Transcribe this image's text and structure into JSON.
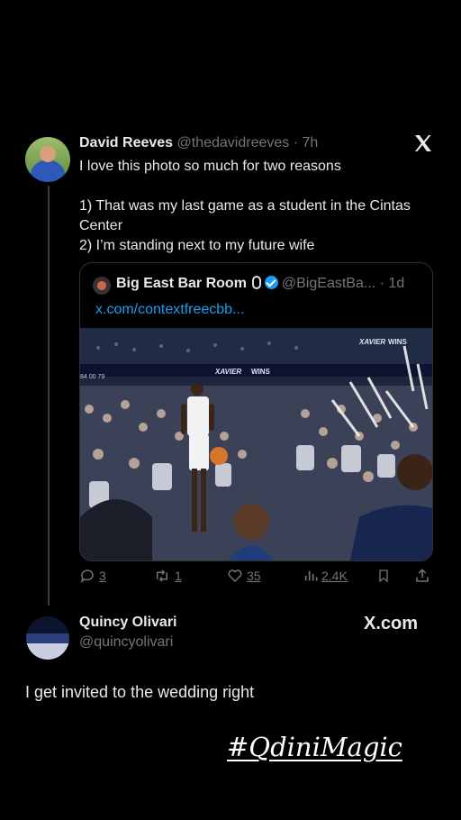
{
  "tweet": {
    "author_name": "David Reeves",
    "author_handle": "@thedavidreeves",
    "time": "· 7h",
    "lines": [
      "I love this photo so much for two reasons",
      "1) That was my last game as a student in the Cintas Center",
      "2) I’m standing next to my future wife"
    ],
    "quote": {
      "name": "Big East Bar Room",
      "handle": "@BigEastBa...",
      "time": "· 1d",
      "link": "x.com/contextfreecbb...",
      "photo_banner": [
        "XAVIER",
        "WINS",
        "XAVIER",
        "WINS"
      ],
      "score_label": "84 00  79"
    },
    "actions": {
      "replies": "3",
      "reposts": "1",
      "likes": "35",
      "views": "2.4K"
    }
  },
  "reply": {
    "author_name": "Quincy Olivari",
    "author_handle": "@quincyolivari",
    "brand": "X.com",
    "text": "I get invited to the wedding right"
  },
  "overlay": {
    "hashtag": "#QdiniMagic"
  },
  "colors": {
    "background": "#000000",
    "text": "#e7e9ea",
    "muted": "#71767b",
    "link": "#1d9bf0"
  }
}
